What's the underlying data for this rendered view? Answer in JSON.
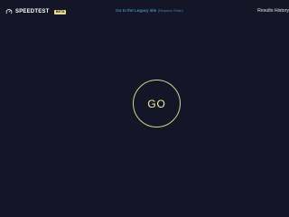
{
  "header": {
    "brand_name": "SPEEDTEST",
    "beta_label": "BETA",
    "brand_icon": "speedometer-icon",
    "legacy_link_text": "Go to the Legacy site",
    "legacy_link_note": "(Requires Flash)",
    "results_label": "Results History"
  },
  "main": {
    "go_label": "GO"
  },
  "colors": {
    "background": "#141527",
    "accent_yellow": "#d8d389",
    "link_blue": "#4fb6e0"
  }
}
